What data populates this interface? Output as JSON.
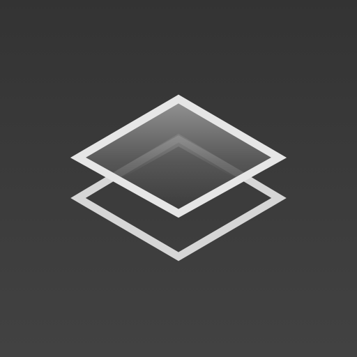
{
  "icon": {
    "name": "layers-icon",
    "colors": {
      "background_top": "#333333",
      "background_bottom": "#424242",
      "stroke": "#e2e2e2",
      "fill_light": "#9a9a9a",
      "fill_dark": "#3a3a3a"
    }
  }
}
